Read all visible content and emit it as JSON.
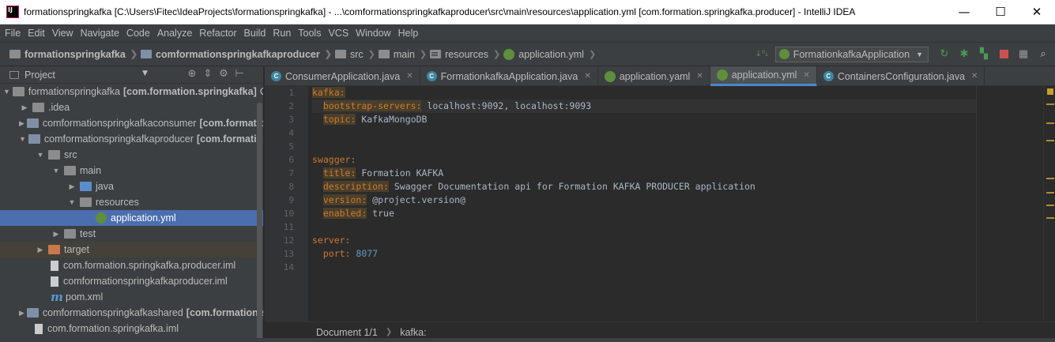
{
  "window": {
    "title": "formationspringkafka [C:\\Users\\Fitec\\IdeaProjects\\formationspringkafka] - ...\\comformationspringkafkaproducer\\src\\main\\resources\\application.yml [com.formation.springkafka.producer] - IntelliJ IDEA",
    "minimize": "—",
    "maximize": "☐",
    "close": "✕"
  },
  "menu": [
    "File",
    "Edit",
    "View",
    "Navigate",
    "Code",
    "Analyze",
    "Refactor",
    "Build",
    "Run",
    "Tools",
    "VCS",
    "Window",
    "Help"
  ],
  "navbar": {
    "crumbs": [
      "formationspringkafka",
      "comformationspringkafkaproducer",
      "src",
      "main",
      "resources",
      "application.yml"
    ],
    "run_config": "FormationkafkaApplication"
  },
  "project_panel": {
    "title": "Project",
    "items": [
      {
        "label": "formationspringkafka",
        "extra": "[com.formation.springkafka]",
        "suffix": "C"
      },
      {
        "label": ".idea",
        "extra": ""
      },
      {
        "label": "comformationspringkafkaconsumer",
        "extra": "[com.formation"
      },
      {
        "label": "comformationspringkafkaproducer",
        "extra": "[com.formation"
      },
      {
        "label": "src",
        "extra": ""
      },
      {
        "label": "main",
        "extra": ""
      },
      {
        "label": "java",
        "extra": ""
      },
      {
        "label": "resources",
        "extra": ""
      },
      {
        "label": "application.yml",
        "extra": ""
      },
      {
        "label": "test",
        "extra": ""
      },
      {
        "label": "target",
        "extra": ""
      },
      {
        "label": "com.formation.springkafka.producer.iml",
        "extra": ""
      },
      {
        "label": "comformationspringkafkaproducer.iml",
        "extra": ""
      },
      {
        "label": "pom.xml",
        "extra": ""
      },
      {
        "label": "comformationspringkafkashared",
        "extra": "[com.formation.s"
      },
      {
        "label": "com.formation.springkafka.iml",
        "extra": ""
      }
    ]
  },
  "tabs": [
    {
      "label": "ConsumerApplication.java",
      "active": false
    },
    {
      "label": "FormationkafkaApplication.java",
      "active": false
    },
    {
      "label": "application.yaml",
      "active": false
    },
    {
      "label": "application.yml",
      "active": true
    },
    {
      "label": "ContainersConfiguration.java",
      "active": false
    }
  ],
  "editor": {
    "line_numbers": [
      "1",
      "2",
      "3",
      "4",
      "5",
      "6",
      "7",
      "8",
      "9",
      "10",
      "11",
      "12",
      "13",
      "14"
    ],
    "code": {
      "l1_key": "kafka:",
      "l2_key": "bootstrap-servers:",
      "l2_val": " localhost:9092, localhost:9093",
      "l3_key": "topic:",
      "l3_val": " KafkaMongoDB",
      "l6_key": "swagger:",
      "l7_key": "title:",
      "l7_val": " Formation KAFKA",
      "l8_key": "description:",
      "l8_val": " Swagger Documentation api for Formation KAFKA PRODUCER application",
      "l9_key": "version:",
      "l9_val": " @project.version@",
      "l10_key": "enabled:",
      "l10_val": " true",
      "l12_key": "server:",
      "l13_key": "port:",
      "l13_val": " 8077"
    },
    "breadcrumb": [
      "Document 1/1",
      "kafka:"
    ]
  },
  "colors": {
    "accent": "#4a88c7",
    "selection": "#4b6eaf",
    "keyword": "#cc7832",
    "number": "#6897bb"
  }
}
